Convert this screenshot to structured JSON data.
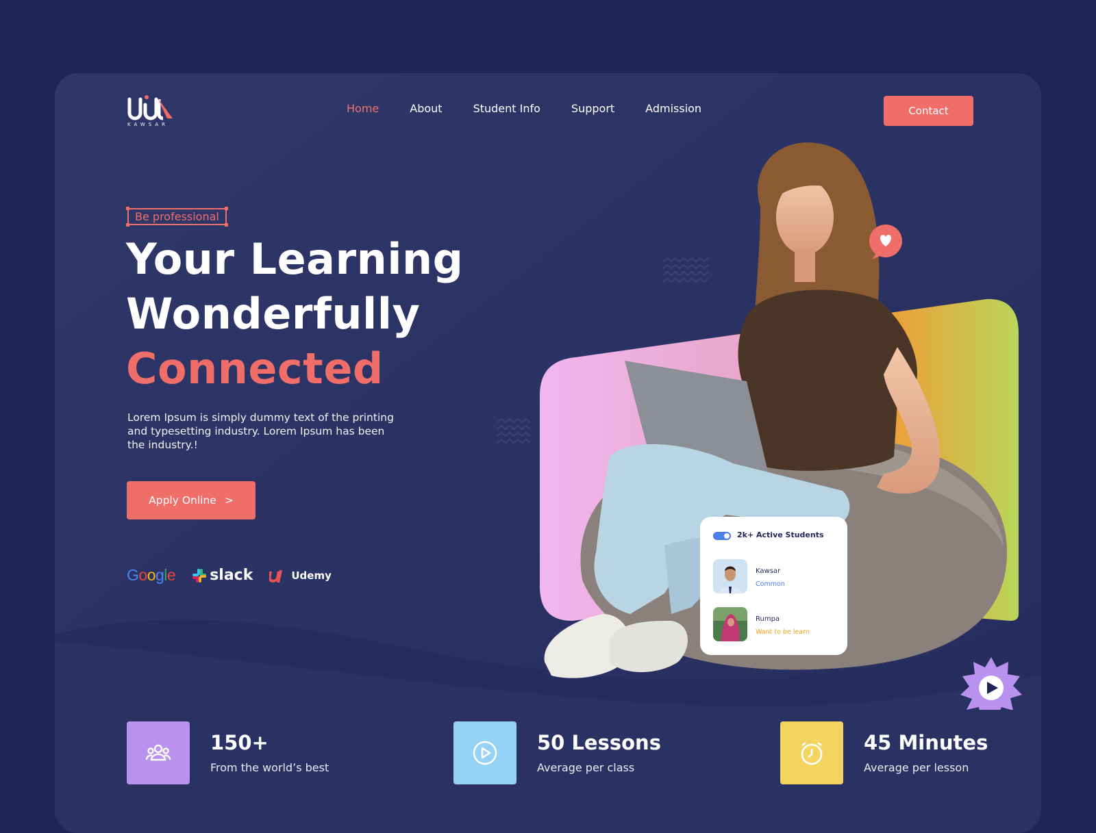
{
  "colors": {
    "background": "#1e2557",
    "card": "#2a3163",
    "accent": "#f06e6a",
    "purple": "#b992ef",
    "sky": "#96d2f5",
    "yellow": "#f2d45e"
  },
  "brand": {
    "logo_letters": "UiU",
    "subtitle": "KAWSAR"
  },
  "nav": {
    "items": [
      {
        "label": "Home",
        "active": true
      },
      {
        "label": "About"
      },
      {
        "label": "Student Info"
      },
      {
        "label": "Support"
      },
      {
        "label": "Admission"
      }
    ],
    "contact_label": "Contact"
  },
  "hero": {
    "tag": "Be professional",
    "headline_line1": "Your Learning",
    "headline_line2": "Wonderfully",
    "headline_accent": "Connected",
    "description": "Lorem Ipsum is simply dummy text of the printing and typesetting industry. Lorem Ipsum has been the industry.!",
    "apply_label": "Apply Online",
    "apply_icon": ">"
  },
  "partners": {
    "google": "Google",
    "slack": "slack",
    "udemy": "Udemy"
  },
  "icons": {
    "heart": "heart-icon",
    "play": "play-icon",
    "users": "users-icon",
    "lesson": "play-circle-icon",
    "clock": "alarm-clock-icon"
  },
  "students_card": {
    "title": "2k+ Active Students",
    "toggle_on": true,
    "students": [
      {
        "name": "Kawsar",
        "role": "Common",
        "role_color": "#4a7ee8"
      },
      {
        "name": "Rumpa",
        "role": "Want to be learn",
        "role_color": "#f2a31b"
      }
    ]
  },
  "stats": [
    {
      "value": "150+",
      "label": "From the world’s best"
    },
    {
      "value": "50 Lessons",
      "label": "Average per class"
    },
    {
      "value": "45 Minutes",
      "label": "Average per lesson"
    }
  ]
}
